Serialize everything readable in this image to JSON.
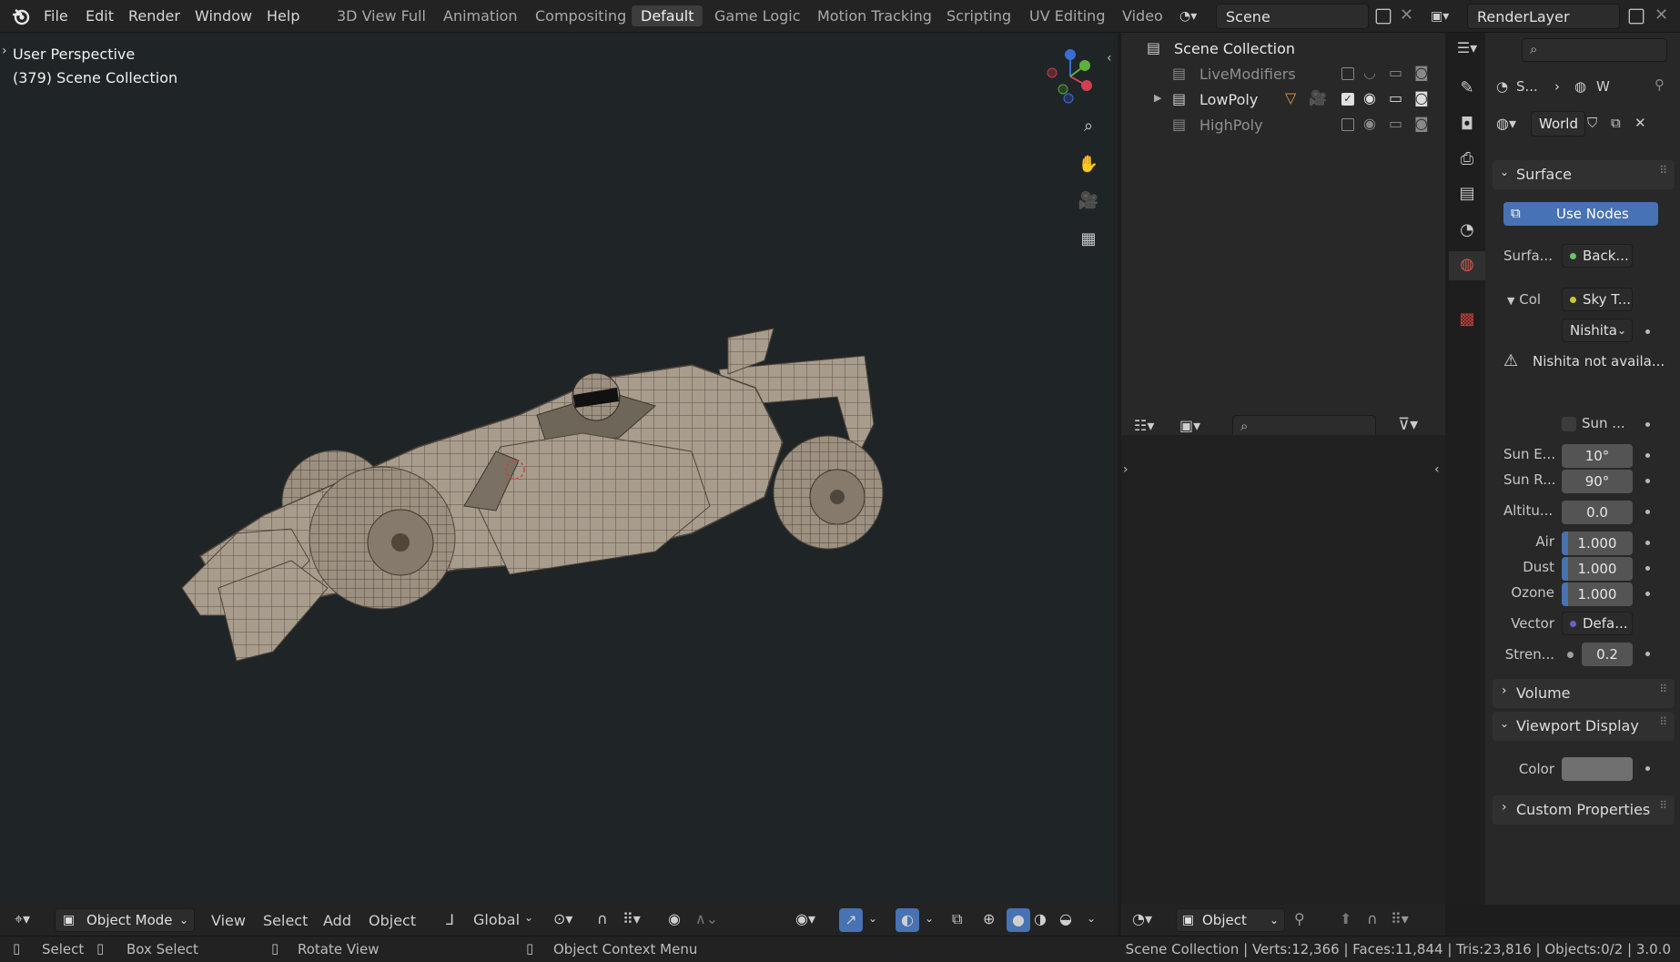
{
  "topbar": {
    "menus": [
      "File",
      "Edit",
      "Render",
      "Window",
      "Help"
    ],
    "workspaces": [
      "3D View Full",
      "Animation",
      "Compositing",
      "Default",
      "Game Logic",
      "Motion Tracking",
      "Scripting",
      "UV Editing",
      "Video I"
    ],
    "active_workspace": "Default",
    "scene": "Scene",
    "view_layer": "RenderLayer"
  },
  "viewport": {
    "perspective_label": "User Perspective",
    "collection_label": "(379) Scene Collection",
    "header": {
      "mode": "Object Mode",
      "menus": [
        "View",
        "Select",
        "Add",
        "Object"
      ],
      "orientation": "Global"
    }
  },
  "outliner": {
    "root": "Scene Collection",
    "items": [
      {
        "name": "LiveModifiers",
        "dim": true
      },
      {
        "name": "LowPoly",
        "dim": false
      },
      {
        "name": "HighPoly",
        "dim": true
      }
    ]
  },
  "editor2": {
    "mode": "Object"
  },
  "properties": {
    "breadcrumb": [
      "S...",
      "W"
    ],
    "datablock": "World",
    "panels": {
      "surface": "Surface",
      "use_nodes": "Use Nodes",
      "surface_label": "Surfa...",
      "surface_value": "Back...",
      "color_label": "Col",
      "color_value": "Sky T...",
      "sky_type": "Nishita",
      "warning": "Nishita not availa...",
      "sun_disc": "Sun ...",
      "rows": [
        {
          "label": "Sun E...",
          "value": "10°"
        },
        {
          "label": "Sun R...",
          "value": "90°"
        },
        {
          "label": "Altitu...",
          "value": "0.0"
        },
        {
          "label": "Air",
          "value": "1.000"
        },
        {
          "label": "Dust",
          "value": "1.000"
        },
        {
          "label": "Ozone",
          "value": "1.000"
        }
      ],
      "vector_label": "Vector",
      "vector_value": "Defa...",
      "strength_label": "Stren...",
      "strength_value": "0.2",
      "volume": "Volume",
      "viewport_display": "Viewport Display",
      "color_prop": "Color",
      "custom_props": "Custom Properties"
    }
  },
  "statusbar": {
    "select": "Select",
    "box_select": "Box Select",
    "rotate": "Rotate View",
    "context": "Object Context Menu",
    "stats": "Scene Collection | Verts:12,366 | Faces:11,844 | Tris:23,816 | Objects:0/2 | 3.0.0"
  },
  "colors": {
    "accent": "#4772b3",
    "viewport_bg": "#1f2527",
    "model": "#a89c8c",
    "world_icon": "#d05a50"
  }
}
